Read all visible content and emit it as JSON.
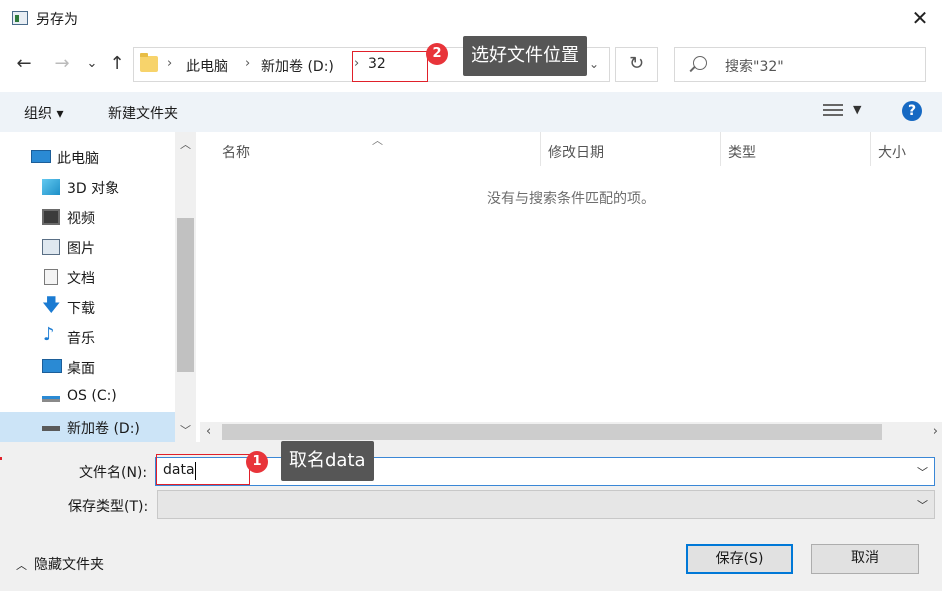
{
  "dialog": {
    "title": "另存为",
    "close_glyph": "✕"
  },
  "nav": {
    "back": "←",
    "forward": "→",
    "recent": "⌄",
    "up": "↑",
    "breadcrumbs": [
      "此电脑",
      "新加卷 (D:)",
      "32"
    ],
    "separator": "›",
    "address_dropdown": "⌄",
    "refresh": "↻",
    "search_placeholder": "搜索\"32\""
  },
  "toolbar": {
    "organize": "组织 ▾",
    "new_folder": "新建文件夹",
    "help": "?",
    "view_dropdown": "▼"
  },
  "sidebar": {
    "items": [
      {
        "label": "此电脑",
        "icon": "computer-icon"
      },
      {
        "label": "3D 对象",
        "icon": "cube-icon"
      },
      {
        "label": "视频",
        "icon": "video-icon"
      },
      {
        "label": "图片",
        "icon": "picture-icon"
      },
      {
        "label": "文档",
        "icon": "document-icon"
      },
      {
        "label": "下载",
        "icon": "download-icon"
      },
      {
        "label": "音乐",
        "icon": "music-icon"
      },
      {
        "label": "桌面",
        "icon": "desktop-icon"
      },
      {
        "label": "OS (C:)",
        "icon": "drive-icon"
      },
      {
        "label": "新加卷 (D:)",
        "icon": "drive-icon"
      }
    ],
    "selected_index": 9
  },
  "columns": [
    "名称",
    "修改日期",
    "类型",
    "大小"
  ],
  "empty_message": "没有与搜索条件匹配的项。",
  "form": {
    "filename_label": "文件名(N):",
    "filename_value": "data",
    "filetype_label": "保存类型(T):",
    "filetype_value": ""
  },
  "footer": {
    "hide_folders": "隐藏文件夹",
    "save": "保存(S)",
    "cancel": "取消"
  },
  "annotations": [
    {
      "number": "1",
      "text": "取名data"
    },
    {
      "number": "2",
      "text": "选好文件位置"
    }
  ],
  "colors": {
    "accent": "#0078d7",
    "annotation_red": "#e8343a",
    "tooltip_bg": "#565656",
    "selected_bg": "#cce4f7"
  }
}
